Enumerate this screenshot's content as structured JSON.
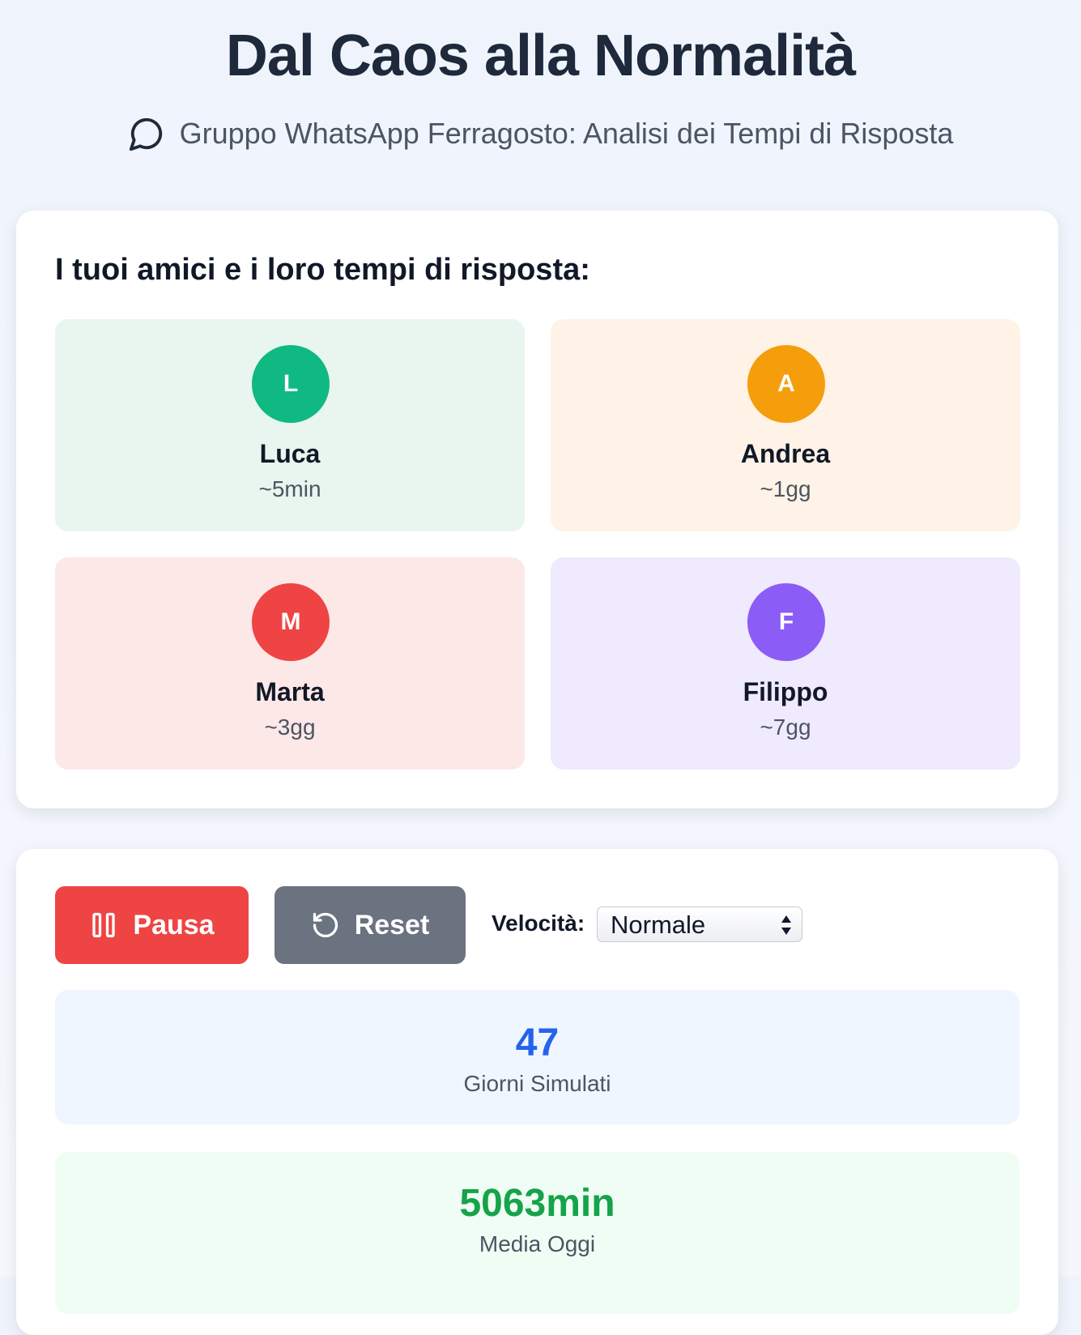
{
  "header": {
    "title": "Dal Caos alla Normalità",
    "subtitle": "Gruppo WhatsApp Ferragosto: Analisi dei Tempi di Risposta",
    "subtitle_icon": "chat-bubble-icon"
  },
  "friends_section": {
    "heading": "I tuoi amici e i loro tempi di risposta:",
    "friends": [
      {
        "initial": "L",
        "name": "Luca",
        "time": "~5min",
        "color": "#10b981",
        "bg": "#e8f6ef"
      },
      {
        "initial": "A",
        "name": "Andrea",
        "time": "~1gg",
        "color": "#f59e0b",
        "bg": "#fef3e6"
      },
      {
        "initial": "M",
        "name": "Marta",
        "time": "~3gg",
        "color": "#ef4444",
        "bg": "#fde8e8"
      },
      {
        "initial": "F",
        "name": "Filippo",
        "time": "~7gg",
        "color": "#8b5cf6",
        "bg": "#efeafd"
      }
    ]
  },
  "controls": {
    "pause_label": "Pausa",
    "pause_icon": "pause-icon",
    "pause_color": "#ef4444",
    "reset_label": "Reset",
    "reset_icon": "reset-icon",
    "reset_color": "#6b7280",
    "speed_label": "Velocità:",
    "speed_value": "Normale"
  },
  "stats": {
    "days_value": "47",
    "days_label": "Giorni Simulati",
    "avg_value": "5063min",
    "avg_label": "Media Oggi"
  }
}
